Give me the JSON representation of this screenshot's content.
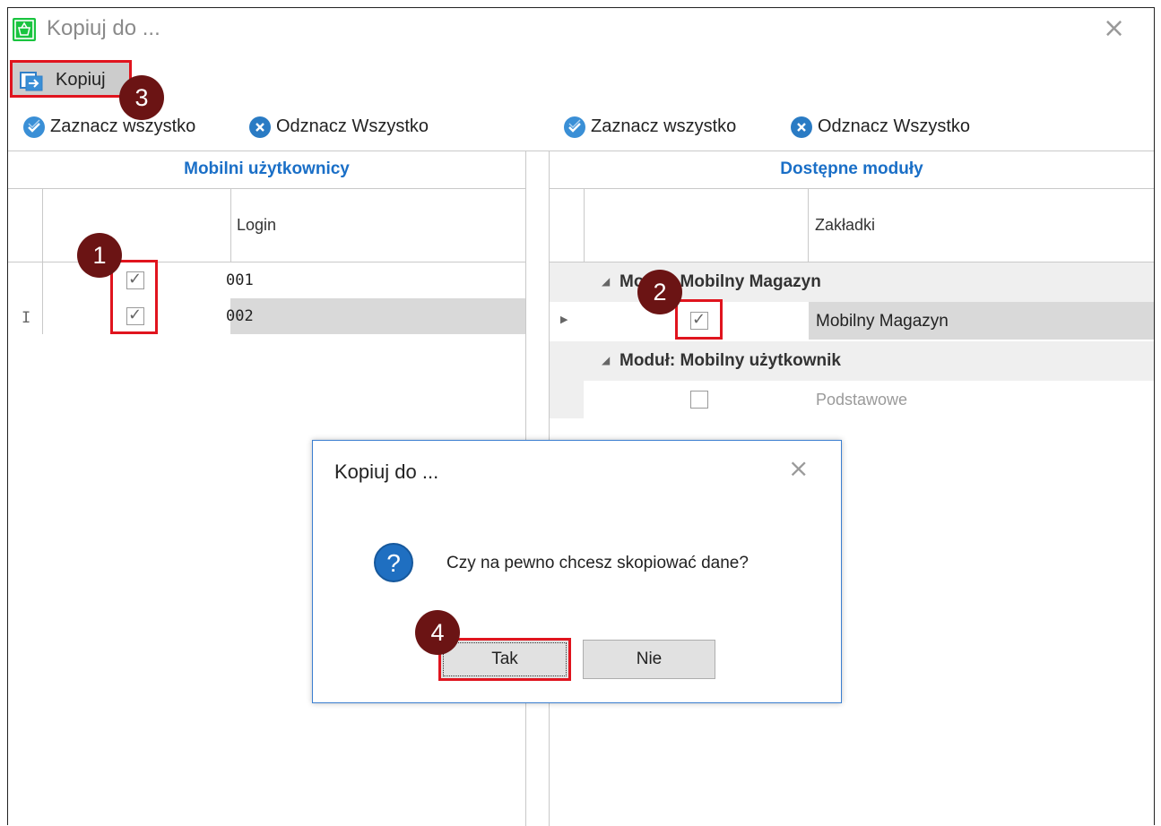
{
  "window": {
    "title": "Kopiuj do ...",
    "close_glyph": "×"
  },
  "toolbar": {
    "copy_label": "Kopiuj",
    "copy_icon": "copy-to-icon"
  },
  "left_panel": {
    "select_all": "Zaznacz wszystko",
    "deselect_all": "Odznacz Wszystko",
    "header": "Mobilni użytkownicy",
    "column_login": "Login",
    "rows": [
      {
        "checked": true,
        "login": "001"
      },
      {
        "checked": true,
        "login": "002"
      }
    ],
    "row_cursor": "I"
  },
  "right_panel": {
    "select_all": "Zaznacz wszystko",
    "deselect_all": "Odznacz Wszystko",
    "header": "Dostępne moduły",
    "column_tabs": "Zakładki",
    "groups": [
      {
        "title": "Moduł: Mobilny Magazyn",
        "items": [
          {
            "checked": true,
            "name": "Mobilny Magazyn"
          }
        ]
      },
      {
        "title": "Moduł: Mobilny użytkownik",
        "items": [
          {
            "checked": false,
            "name": "Podstawowe"
          }
        ]
      }
    ]
  },
  "dialog": {
    "title": "Kopiuj do ...",
    "message": "Czy na pewno chcesz skopiować dane?",
    "yes_label": "Tak",
    "no_label": "Nie",
    "close_glyph": "×"
  },
  "annotations": {
    "badge_1": "1",
    "badge_2": "2",
    "badge_3": "3",
    "badge_4": "4"
  },
  "colors": {
    "accent": "#1a6fc7",
    "highlight": "#e0141e",
    "badge": "#6b1414",
    "app_icon": "#19c43f",
    "selected_row": "#d9d9d9"
  }
}
